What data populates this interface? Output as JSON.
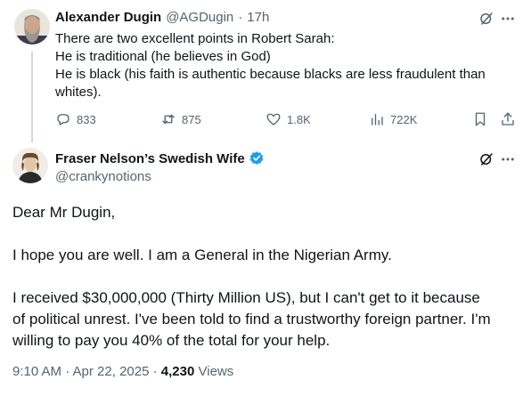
{
  "reply_to": {
    "display_name": "Alexander Dugin",
    "handle": "@AGDugin",
    "separator": "·",
    "time": "17h",
    "lines": [
      "There are two excellent points in Robert Sarah:",
      "He is traditional (he believes in God)",
      "He is black (his faith is authentic because blacks are less fraudulent than",
      "whites)."
    ],
    "actions": {
      "replies": "833",
      "reposts": "875",
      "likes": "1.8K",
      "views": "722K"
    }
  },
  "main_tweet": {
    "display_name": "Fraser Nelson’s Swedish Wife",
    "handle": "@crankynotions",
    "paragraphs": [
      "Dear Mr Dugin,",
      "I hope you are well. I am a General in the Nigerian Army.",
      "I received $30,000,000 (Thirty Million US), but I can't get to it because",
      "of political unrest. I've been told to find a trustworthy foreign partner. I'm",
      "willing to pay you 40% of the total for your help."
    ],
    "timestamp": "9:10 AM · Apr 22, 2025 ·",
    "views_count": "4,230",
    "views_label": "Views"
  },
  "colors": {
    "text": "#0f1419",
    "secondary": "#536471",
    "verified": "#1d9bf0",
    "thread_line": "#cfd9de"
  },
  "icons": [
    "grok-icon",
    "more-icon",
    "reply-icon",
    "repost-icon",
    "like-icon",
    "views-icon",
    "bookmark-icon",
    "share-icon",
    "verified-badge-icon"
  ]
}
